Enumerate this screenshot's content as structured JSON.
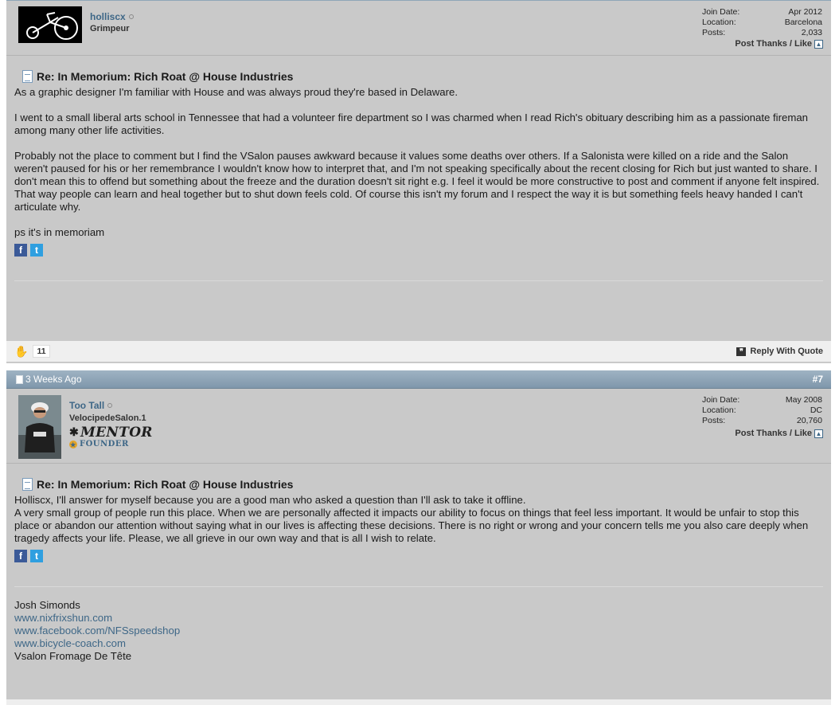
{
  "posts": [
    {
      "user": {
        "name": "holliscx",
        "title": "Grimpeur"
      },
      "stats": {
        "join_label": "Join Date:",
        "join_value": "Apr 2012",
        "location_label": "Location:",
        "location_value": "Barcelona",
        "posts_label": "Posts:",
        "posts_value": "2,033"
      },
      "thanks_label": "Post Thanks / Like",
      "title": "Re: In Memorium: Rich Roat @ House Industries",
      "paragraphs": [
        "As a graphic designer I'm familiar with House and was always proud they're based in Delaware.",
        "I went to a small liberal arts school in Tennessee that had a volunteer fire department so I was charmed when I read Rich's obituary describing him as a passionate fireman among many other life activities.",
        "Probably not the place to comment but I find the VSalon pauses awkward because it values some deaths over others. If a Salonista were killed on a ride and the Salon weren't paused for his or her remembrance I wouldn't know how to interpret that, and I'm not speaking specifically about the recent closing for Rich but just wanted to share. I don't mean this to offend but something about the freeze and the duration doesn't sit right e.g. I feel it would be more constructive to post and comment if anyone felt inspired. That way people can learn and heal together but to shut down feels cold. Of course this isn't my forum and I respect the way it is but something feels heavy handed I can't articulate why.",
        "ps it's in memoriam"
      ],
      "likes": "11",
      "reply_label": "Reply With Quote"
    },
    {
      "header": {
        "date": "3 Weeks Ago",
        "number": "#7"
      },
      "user": {
        "name": "Too Tall",
        "title": "VelocipedeSalon.1",
        "badge_mentor": "MENTOR",
        "badge_founder": "FOUNDER"
      },
      "stats": {
        "join_label": "Join Date:",
        "join_value": "May 2008",
        "location_label": "Location:",
        "location_value": "DC",
        "posts_label": "Posts:",
        "posts_value": "20,760"
      },
      "thanks_label": "Post Thanks / Like",
      "title": "Re: In Memorium: Rich Roat @ House Industries",
      "paragraphs": [
        "Holliscx, I'll answer for myself because you are a good man who asked a question than I'll ask to take it offline.",
        "A very small group of people run this place. When we are personally affected it impacts our ability to focus on things that feel less important. It would be unfair to stop this place or abandon our attention without saying what in our lives is affecting these decisions. There is no right or wrong and your concern tells me you also care deeply when tragedy affects your life. Please, we all grieve in our own way and that is all I wish to relate."
      ],
      "signature": {
        "name": "Josh Simonds",
        "links": [
          "www.nixfrixshun.com",
          "www.facebook.com/NFSspeedshop",
          "www.bicycle-coach.com"
        ],
        "tagline": "Vsalon Fromage De Tête"
      }
    }
  ],
  "icons": {
    "facebook": "f",
    "twitter": "t"
  }
}
